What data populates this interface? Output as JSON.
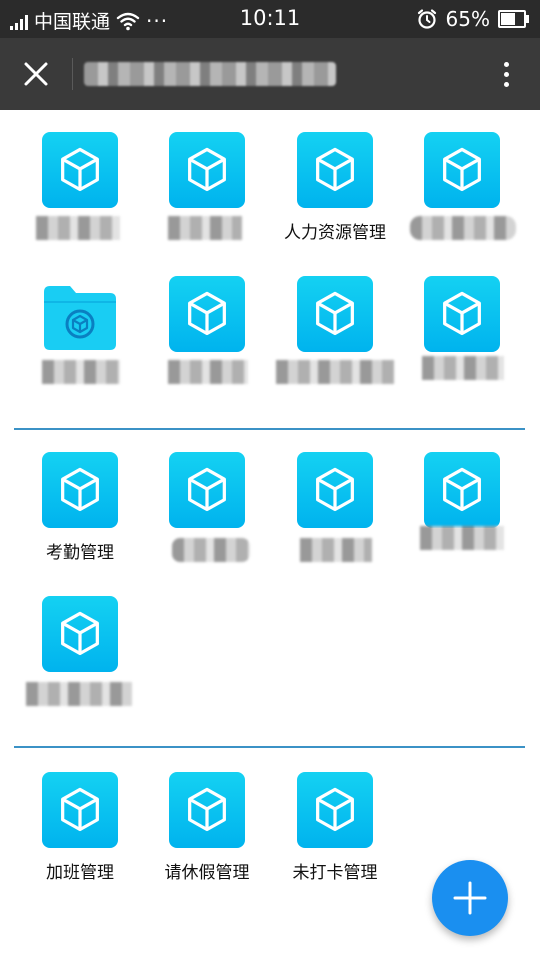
{
  "status_bar": {
    "carrier": "中国联通",
    "more": "···",
    "time": "10:11",
    "battery_percent_text": "65%",
    "battery_level": 0.65,
    "icons": [
      "signal-icon",
      "wifi-icon",
      "alarm-icon",
      "battery-icon"
    ]
  },
  "title_bar": {
    "close_icon": "close-icon",
    "more_icon": "more-vertical-icon"
  },
  "sections": [
    {
      "apps": [
        {
          "label": "",
          "icon": "cube-icon"
        },
        {
          "label": "",
          "icon": "cube-icon"
        },
        {
          "label": "人力资源管理",
          "icon": "cube-icon"
        },
        {
          "label": "",
          "icon": "cube-icon"
        },
        {
          "label": "",
          "icon": "folder-icon"
        },
        {
          "label": "",
          "icon": "cube-icon"
        },
        {
          "label": "",
          "icon": "cube-icon"
        },
        {
          "label": "",
          "icon": "cube-icon"
        }
      ]
    },
    {
      "apps": [
        {
          "label": "考勤管理",
          "icon": "cube-icon"
        },
        {
          "label": "",
          "icon": "cube-icon"
        },
        {
          "label": "",
          "icon": "cube-icon"
        },
        {
          "label": "",
          "icon": "cube-icon"
        },
        {
          "label": "",
          "icon": "cube-icon"
        }
      ]
    },
    {
      "apps": [
        {
          "label": "加班管理",
          "icon": "cube-icon"
        },
        {
          "label": "请休假管理",
          "icon": "cube-icon"
        },
        {
          "label": "未打卡管理",
          "icon": "cube-icon"
        }
      ]
    }
  ],
  "fab": {
    "icon": "plus-icon"
  },
  "colors": {
    "accent": "#00b3ee",
    "fab": "#1a8ff0",
    "divider": "#3b92c6",
    "title_bar": "#3a3a3a",
    "status_bar": "#2b2b2b"
  }
}
